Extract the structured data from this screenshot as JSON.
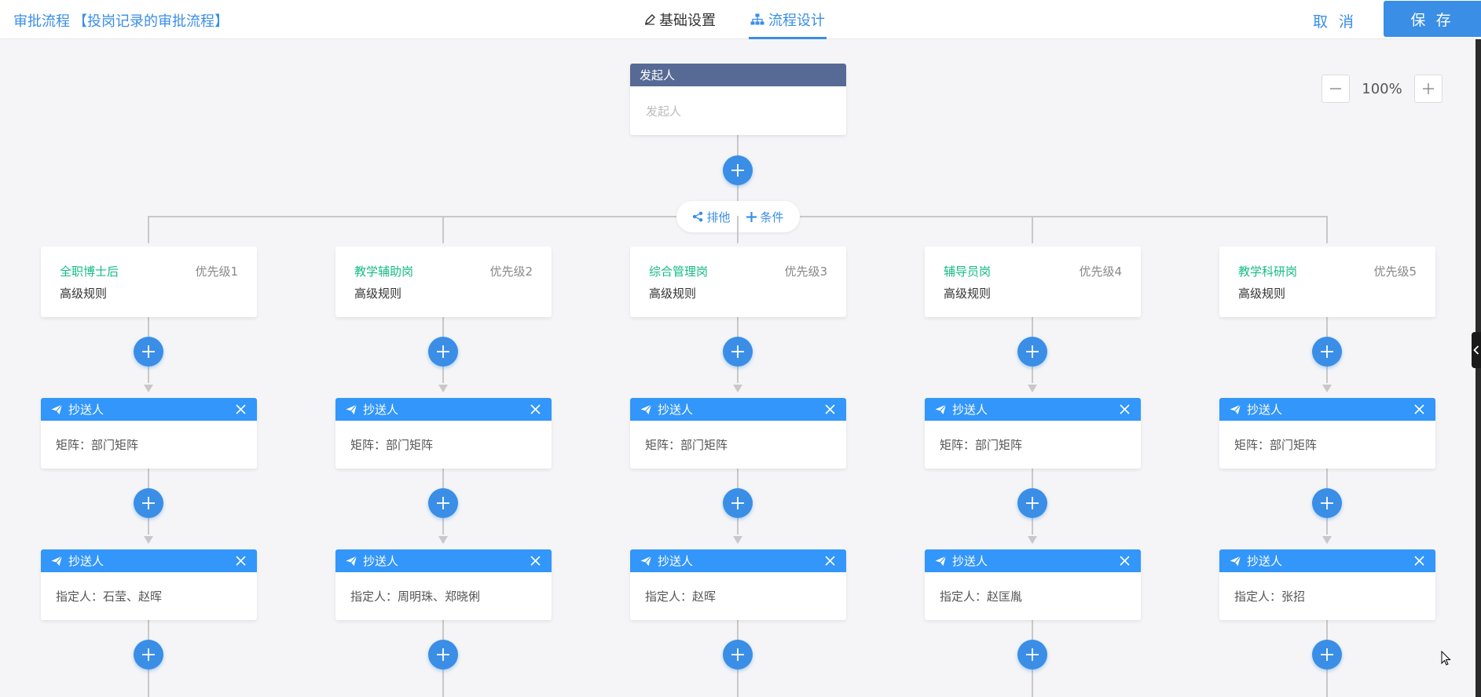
{
  "header": {
    "title": "审批流程",
    "subtitle": "【投岗记录的审批流程】",
    "tabs": [
      {
        "label": "基础设置",
        "icon": "pencil-icon"
      },
      {
        "label": "流程设计",
        "icon": "org-tree-icon",
        "active": true
      }
    ],
    "cancel_label": "取 消",
    "save_label": "保 存"
  },
  "zoom": {
    "value": "100%"
  },
  "start_node": {
    "header": "发起人",
    "body": "发起人"
  },
  "branch_actions": {
    "exclusive": "排他",
    "add_condition": "条件"
  },
  "branches": [
    {
      "condition": "全职博士后",
      "priority": "优先级1",
      "rule": "高级规则",
      "cc1": {
        "title": "抄送人",
        "body": "矩阵：部门矩阵"
      },
      "cc2": {
        "title": "抄送人",
        "body": "指定人：石莹、赵晖"
      }
    },
    {
      "condition": "教学辅助岗",
      "priority": "优先级2",
      "rule": "高级规则",
      "cc1": {
        "title": "抄送人",
        "body": "矩阵：部门矩阵"
      },
      "cc2": {
        "title": "抄送人",
        "body": "指定人：周明珠、郑晓俐"
      }
    },
    {
      "condition": "综合管理岗",
      "priority": "优先级3",
      "rule": "高级规则",
      "cc1": {
        "title": "抄送人",
        "body": "矩阵：部门矩阵"
      },
      "cc2": {
        "title": "抄送人",
        "body": "指定人：赵晖"
      }
    },
    {
      "condition": "辅导员岗",
      "priority": "优先级4",
      "rule": "高级规则",
      "cc1": {
        "title": "抄送人",
        "body": "矩阵：部门矩阵"
      },
      "cc2": {
        "title": "抄送人",
        "body": "指定人：赵匡胤"
      }
    },
    {
      "condition": "教学科研岗",
      "priority": "优先级5",
      "rule": "高级规则",
      "cc1": {
        "title": "抄送人",
        "body": "矩阵：部门矩阵"
      },
      "cc2": {
        "title": "抄送人",
        "body": "指定人：张招"
      }
    }
  ],
  "colors": {
    "primary": "#3a8ee6",
    "cc_header": "#3296fa",
    "start_header": "#576a95",
    "condition_text": "#15bc83"
  }
}
